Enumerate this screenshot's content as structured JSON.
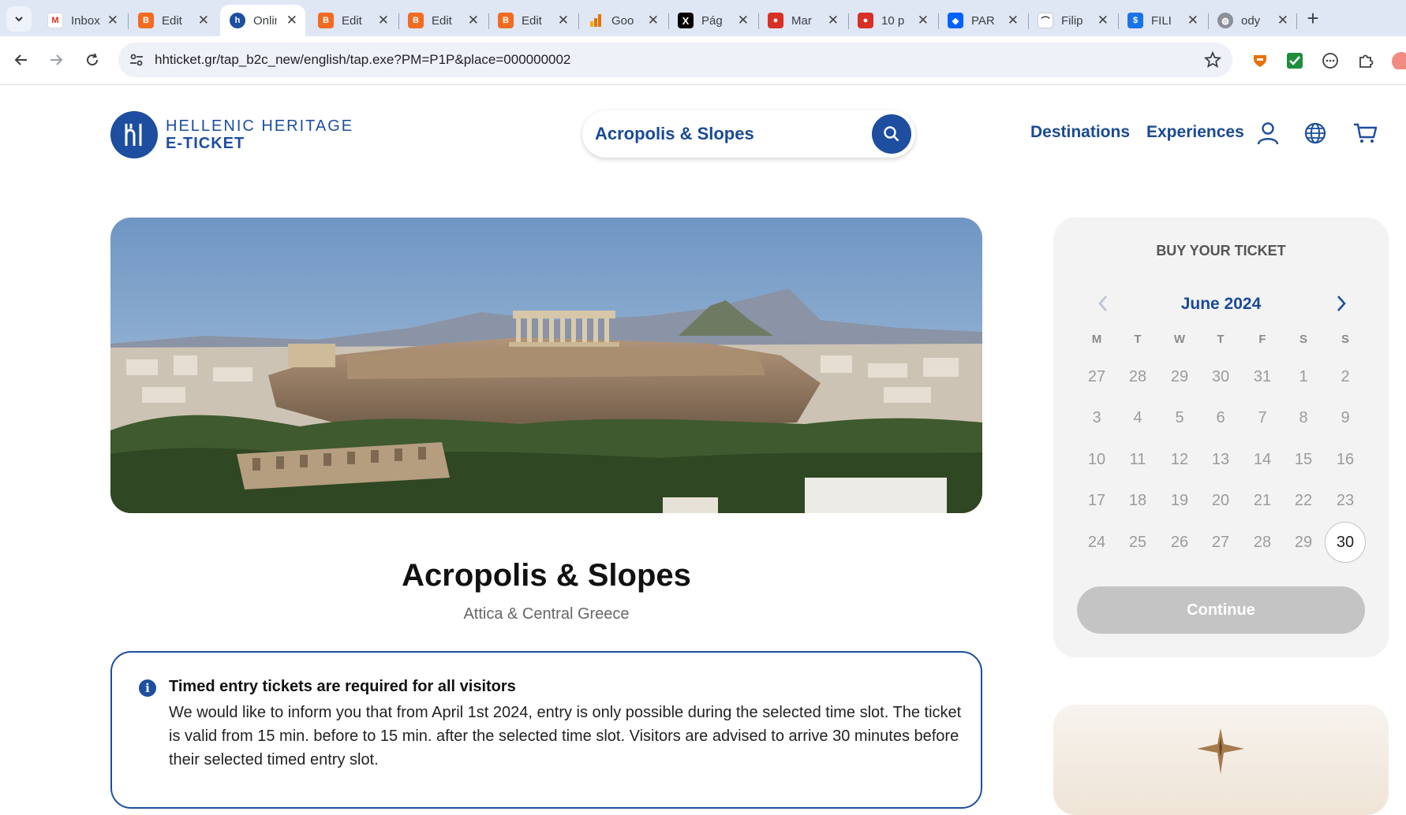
{
  "browser": {
    "tabs": [
      {
        "title": "Inbox",
        "favicon": "gmail-icon"
      },
      {
        "title": "Edit",
        "favicon": "blogger-edit-icon"
      },
      {
        "title": "Online Tickets",
        "favicon": "hellenic-heritage-icon",
        "active": true
      },
      {
        "title": "Edit",
        "favicon": "blogger-edit-icon"
      },
      {
        "title": "Edit",
        "favicon": "blogger-edit-icon"
      },
      {
        "title": "Edit",
        "favicon": "blogger-edit-icon"
      },
      {
        "title": "Goo",
        "favicon": "analytics-icon"
      },
      {
        "title": "Pág",
        "favicon": "x-icon"
      },
      {
        "title": "Mar",
        "favicon": "maps-pin-icon"
      },
      {
        "title": "10 p",
        "favicon": "maps-pin-icon"
      },
      {
        "title": "PAR",
        "favicon": "dropbox-icon"
      },
      {
        "title": "Filip",
        "favicon": "site-icon"
      },
      {
        "title": "FILI",
        "favicon": "dollar-icon"
      },
      {
        "title": "ody",
        "favicon": "globe-icon"
      }
    ],
    "url": "hhticket.gr/tap_b2c_new/english/tap.exe?PM=P1P&place=000000002"
  },
  "header": {
    "logo_line1": "HELLENIC HERITAGE",
    "logo_line2": "E-TICKET",
    "search_value": "Acropolis & Slopes",
    "nav": [
      "Destinations",
      "Experiences"
    ]
  },
  "main": {
    "title": "Acropolis & Slopes",
    "subtitle": "Attica & Central Greece",
    "notice": {
      "title": "Timed entry tickets are required for all visitors",
      "body": "We would like to inform you that from April 1st 2024, entry is only possible during the selected time slot. The ticket is valid from 15 min. before to 15 min. after the selected time slot. Visitors are advised to arrive 30 minutes before their selected timed entry slot."
    }
  },
  "booking": {
    "title": "BUY YOUR TICKET",
    "month": "June 2024",
    "weekdays": [
      "M",
      "T",
      "W",
      "T",
      "F",
      "S",
      "S"
    ],
    "weeks": [
      [
        "27",
        "28",
        "29",
        "30",
        "31",
        "1",
        "2"
      ],
      [
        "3",
        "4",
        "5",
        "6",
        "7",
        "8",
        "9"
      ],
      [
        "10",
        "11",
        "12",
        "13",
        "14",
        "15",
        "16"
      ],
      [
        "17",
        "18",
        "19",
        "20",
        "21",
        "22",
        "23"
      ],
      [
        "24",
        "25",
        "26",
        "27",
        "28",
        "29",
        "30"
      ]
    ],
    "selected_day": "30",
    "continue_label": "Continue"
  },
  "colors": {
    "brand": "#1d4e9f",
    "link": "#1a4a93",
    "disabled_button": "#c4c4c4"
  }
}
